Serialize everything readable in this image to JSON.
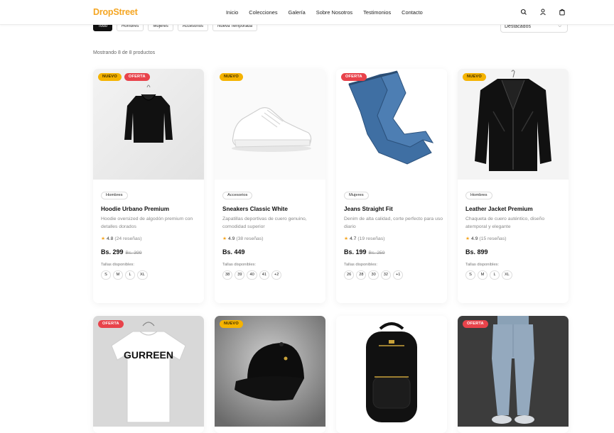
{
  "header": {
    "logo": "DropStreet",
    "nav": [
      "Inicio",
      "Colecciones",
      "Galería",
      "Sobre Nosotros",
      "Testimonios",
      "Contacto"
    ],
    "icons": [
      "search-icon",
      "user-icon",
      "bag-icon"
    ]
  },
  "filters": {
    "chips": [
      "Todo",
      "Hombres",
      "Mujeres",
      "Accesorios",
      "Nueva Temporada"
    ],
    "active": "Todo"
  },
  "sort": {
    "selected": "Destacados"
  },
  "results": {
    "count_text": "Mostrando 8 de 8 productos"
  },
  "colors": {
    "brand": "#f5a623",
    "nuevo_badge": "#f5b300",
    "oferta_badge": "#e8434b"
  },
  "products": [
    {
      "badges": [
        "NUEVO",
        "OFERTA"
      ],
      "category": "Hombres",
      "name": "Hoodie Urbano Premium",
      "description": "Hoodie oversized de algodón premium con detalles dorados",
      "rating": "4.8",
      "reviews": "(24 reseñas)",
      "price": "Bs. 299",
      "old_price": "Bs. 399",
      "sizes_label": "Tallas disponibles:",
      "sizes": [
        "S",
        "M",
        "L",
        "XL"
      ],
      "image": "black-hoodie"
    },
    {
      "badges": [
        "NUEVO"
      ],
      "category": "Accesorios",
      "name": "Sneakers Classic White",
      "description": "Zapatillas deportivas de cuero genuino, comodidad superior",
      "rating": "4.9",
      "reviews": "(38 reseñas)",
      "price": "Bs. 449",
      "old_price": "",
      "sizes_label": "Tallas disponibles:",
      "sizes": [
        "38",
        "39",
        "40",
        "41",
        "+2"
      ],
      "image": "white-sneaker"
    },
    {
      "badges": [
        "OFERTA"
      ],
      "category": "Mujeres",
      "name": "Jeans Straight Fit",
      "description": "Denim de alta calidad, corte perfecto para uso diario",
      "rating": "4.7",
      "reviews": "(19 reseñas)",
      "price": "Bs. 199",
      "old_price": "Bs. 259",
      "sizes_label": "Tallas disponibles:",
      "sizes": [
        "26",
        "28",
        "30",
        "32",
        "+1"
      ],
      "image": "blue-jeans"
    },
    {
      "badges": [
        "NUEVO"
      ],
      "category": "Hombres",
      "name": "Leather Jacket Premium",
      "description": "Chaqueta de cuero auténtico, diseño atemporal y elegante",
      "rating": "4.9",
      "reviews": "(15 reseñas)",
      "price": "Bs. 899",
      "old_price": "",
      "sizes_label": "Tallas disponibles:",
      "sizes": [
        "S",
        "M",
        "L",
        "XL"
      ],
      "image": "leather-jacket"
    },
    {
      "badges": [
        "OFERTA"
      ],
      "image": "white-tshirt",
      "tshirt_print": "GURREEN"
    },
    {
      "badges": [
        "NUEVO"
      ],
      "image": "black-cap"
    },
    {
      "badges": [],
      "image": "black-backpack"
    },
    {
      "badges": [
        "OFERTA"
      ],
      "image": "grey-joggers"
    }
  ]
}
